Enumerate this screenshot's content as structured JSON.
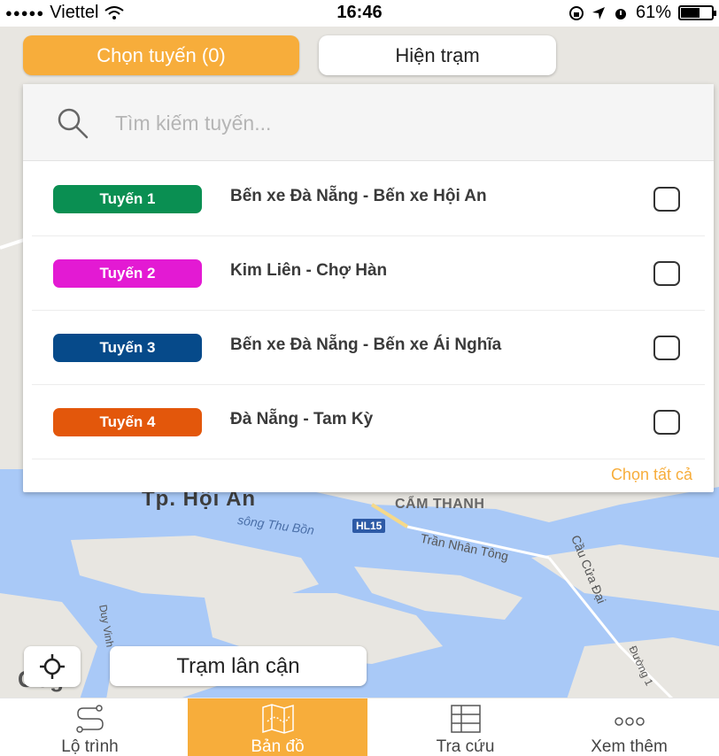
{
  "status_bar": {
    "carrier": "Viettel",
    "time": "16:46",
    "battery": "61%",
    "battery_level": 0.61
  },
  "top_buttons": {
    "routes_label": "Chọn tuyến (0)",
    "stations_label": "Hiện trạm"
  },
  "search": {
    "placeholder": "Tìm kiếm tuyến...",
    "value": ""
  },
  "routes": [
    {
      "badge": "Tuyến 1",
      "name": "Bến xe Đà Nẵng - Bến xe Hội An",
      "color": "#0a8f52",
      "checked": false
    },
    {
      "badge": "Tuyến 2",
      "name": "Kim Liên - Chợ Hàn",
      "color": "#e31ad3",
      "checked": false
    },
    {
      "badge": "Tuyến 3",
      "name": "Bến xe Đà Nẵng - Bến xe Ái Nghĩa",
      "color": "#064a8a",
      "checked": false
    },
    {
      "badge": "Tuyến 4",
      "name": "Đà Nẵng - Tam Kỳ",
      "color": "#e3570b",
      "checked": false
    }
  ],
  "select_all_label": "Chọn tất cả",
  "map": {
    "city_label": "Tp. Hội An",
    "ward_label": "CẨM THANH",
    "river_label": "sông Thu Bồn",
    "road_badge": "HL15",
    "street_1": "Trần Nhân Tông",
    "street_2": "Cầu Cửa Đại",
    "street_3": "Duy Vinh",
    "street_4": "Đường 1",
    "google_label": "Gogl"
  },
  "map_buttons": {
    "nearby_label": "Trạm lân cận"
  },
  "tabs": [
    {
      "label": "Lộ trình",
      "icon": "route-icon",
      "active": false
    },
    {
      "label": "Bản đồ",
      "icon": "map-icon",
      "active": true
    },
    {
      "label": "Tra cứu",
      "icon": "table-icon",
      "active": false
    },
    {
      "label": "Xem thêm",
      "icon": "more-icon",
      "active": false
    }
  ],
  "colors": {
    "accent": "#f7ad3b",
    "water": "#a9c9f7",
    "land": "#e8e6e1"
  }
}
